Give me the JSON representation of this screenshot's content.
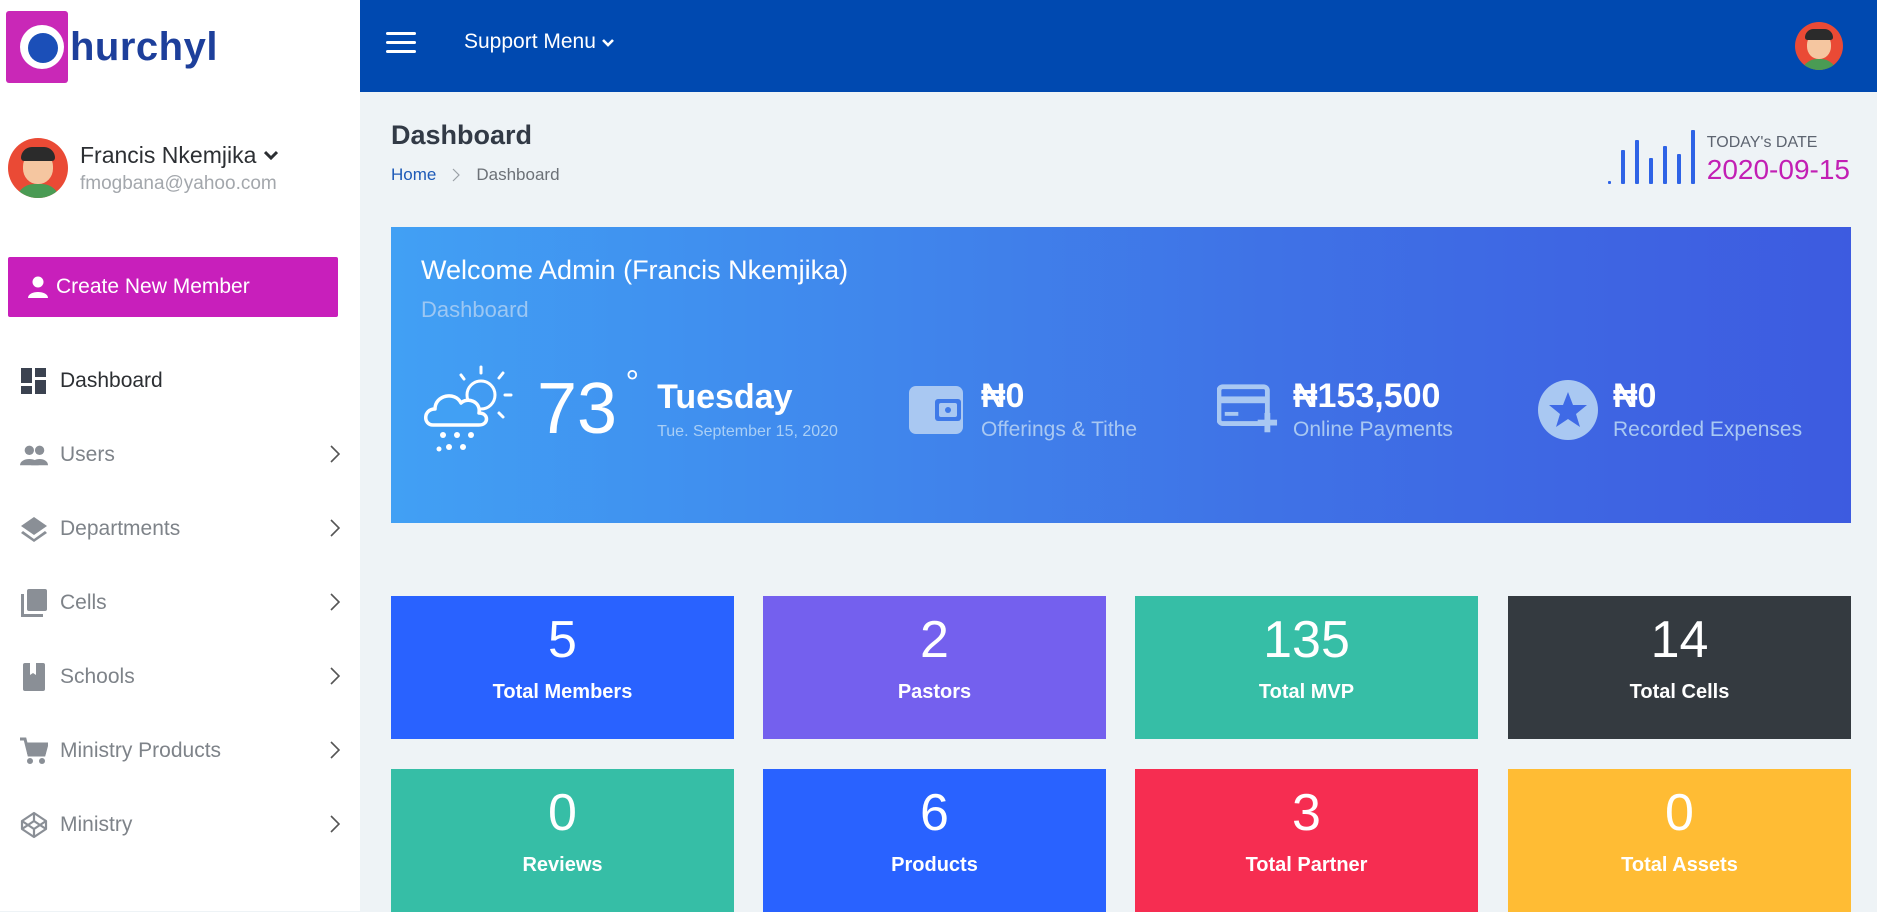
{
  "app": {
    "logo_text": "hurchyl"
  },
  "user": {
    "name": "Francis Nkemjika",
    "email": "fmogbana@yahoo.com"
  },
  "sidebar": {
    "create_label": "Create New Member",
    "items": [
      {
        "label": "Dashboard",
        "icon": "dashboard-icon"
      },
      {
        "label": "Users",
        "icon": "users-icon"
      },
      {
        "label": "Departments",
        "icon": "layers-icon"
      },
      {
        "label": "Cells",
        "icon": "library-icon"
      },
      {
        "label": "Schools",
        "icon": "book-icon"
      },
      {
        "label": "Ministry Products",
        "icon": "cart-icon"
      },
      {
        "label": "Ministry",
        "icon": "codepen-icon"
      }
    ]
  },
  "topbar": {
    "support_menu": "Support Menu"
  },
  "header": {
    "title": "Dashboard",
    "breadcrumb": {
      "home": "Home",
      "current": "Dashboard"
    },
    "date_label": "TODAY's DATE",
    "date_value": "2020-09-15"
  },
  "banner": {
    "welcome": "Welcome Admin (Francis Nkemjika)",
    "subtitle": "Dashboard",
    "temperature": "73",
    "degree": "°",
    "day": "Tuesday",
    "full_date": "Tue. September 15, 2020",
    "stats": [
      {
        "amount": "₦0",
        "label": "Offerings & Tithe",
        "icon": "wallet-icon"
      },
      {
        "amount": "₦153,500",
        "label": "Online Payments",
        "icon": "credit-card-plus-icon"
      },
      {
        "amount": "₦0",
        "label": "Recorded Expenses",
        "icon": "star-circle-icon"
      }
    ]
  },
  "tiles": [
    {
      "value": "5",
      "label": "Total Members",
      "color": "#2962ff"
    },
    {
      "value": "2",
      "label": "Pastors",
      "color": "#7460ee"
    },
    {
      "value": "135",
      "label": "Total MVP",
      "color": "#36bea6"
    },
    {
      "value": "14",
      "label": "Total Cells",
      "color": "#343a40"
    },
    {
      "value": "0",
      "label": "Reviews",
      "color": "#36bea6"
    },
    {
      "value": "6",
      "label": "Products",
      "color": "#2962ff"
    },
    {
      "value": "3",
      "label": "Total Partner",
      "color": "#f62d51"
    },
    {
      "value": "0",
      "label": "Total Assets",
      "color": "#ffbc34"
    }
  ]
}
